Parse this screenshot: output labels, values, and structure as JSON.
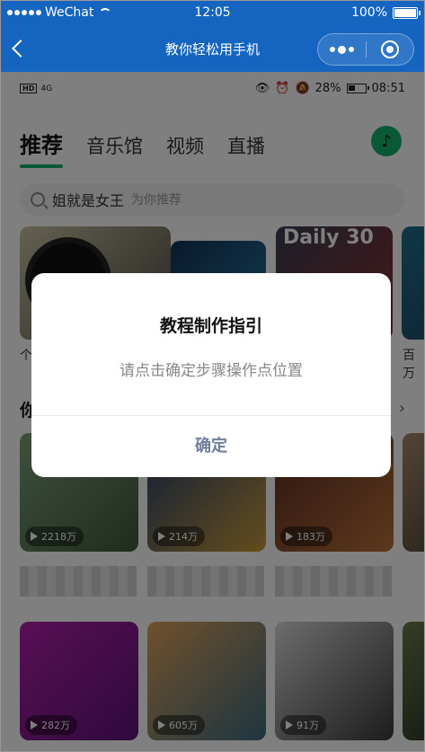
{
  "ios_status": {
    "carrier": "WeChat",
    "time": "12:05",
    "battery": "100%"
  },
  "mp_nav": {
    "title": "教你轻松用手机"
  },
  "android_status": {
    "badge1": "HD",
    "badge2": "4G",
    "battery": "28%",
    "time": "08:51"
  },
  "tabs": [
    {
      "label": "推荐",
      "active": true
    },
    {
      "label": "音乐馆"
    },
    {
      "label": "视频"
    },
    {
      "label": "直播"
    }
  ],
  "search": {
    "query": "姐就是女王",
    "hint": "为你推荐"
  },
  "banners": {
    "caption_left": "个",
    "caption_right": "百万",
    "daily_label": "Daily 30"
  },
  "section": {
    "title": "你"
  },
  "cards": [
    {
      "plays": "2218万"
    },
    {
      "plays": "214万"
    },
    {
      "plays": "183万"
    },
    {
      "plays": "282万"
    },
    {
      "plays": "605万"
    },
    {
      "plays": "91万"
    }
  ],
  "dialog": {
    "title": "教程制作指引",
    "message": "请点击确定步骤操作点位置",
    "confirm_label": "确定"
  },
  "colors": {
    "nav_blue": "#1565c0",
    "accent_green": "#13b36f",
    "confirm_text": "#6f7f9a"
  }
}
